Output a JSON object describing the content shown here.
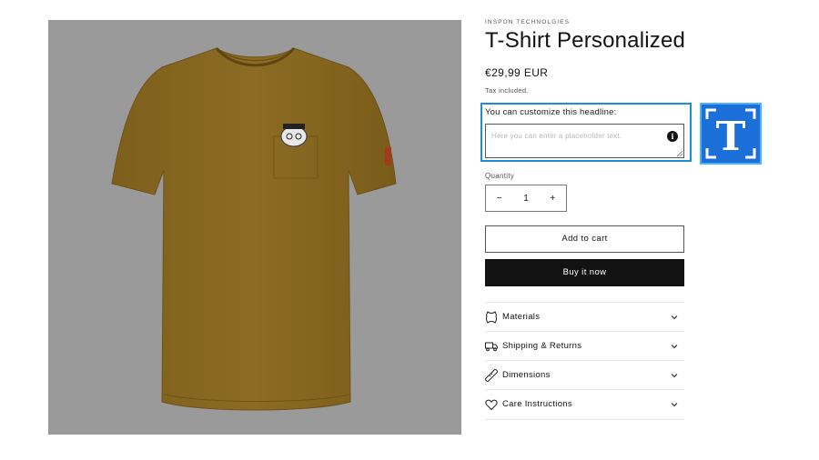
{
  "product": {
    "vendor": "INSPON TECHNOLGIES",
    "title": "T-Shirt Personalized",
    "price": "€29,99 EUR",
    "tax_note": "Tax included."
  },
  "customize": {
    "label": "You can customize this headline:",
    "placeholder": "Here you can enter a placeholder text.",
    "info_icon": "info-icon"
  },
  "logo": {
    "letter": "T"
  },
  "quantity": {
    "label": "Quantity",
    "minus": "−",
    "value": "1",
    "plus": "+"
  },
  "buttons": {
    "add_to_cart": "Add to cart",
    "buy_now": "Buy it now"
  },
  "accordion": [
    {
      "label": "Materials",
      "icon": "leather-icon"
    },
    {
      "label": "Shipping & Returns",
      "icon": "truck-icon"
    },
    {
      "label": "Dimensions",
      "icon": "ruler-icon"
    },
    {
      "label": "Care Instructions",
      "icon": "heart-icon"
    }
  ],
  "colors": {
    "gallery_bg": "#9a9a9a",
    "shirt": "#8a6a22",
    "accent_blue": "#1b8ed6",
    "logo_blue": "#1a6fd8",
    "button_dark": "#121212"
  }
}
